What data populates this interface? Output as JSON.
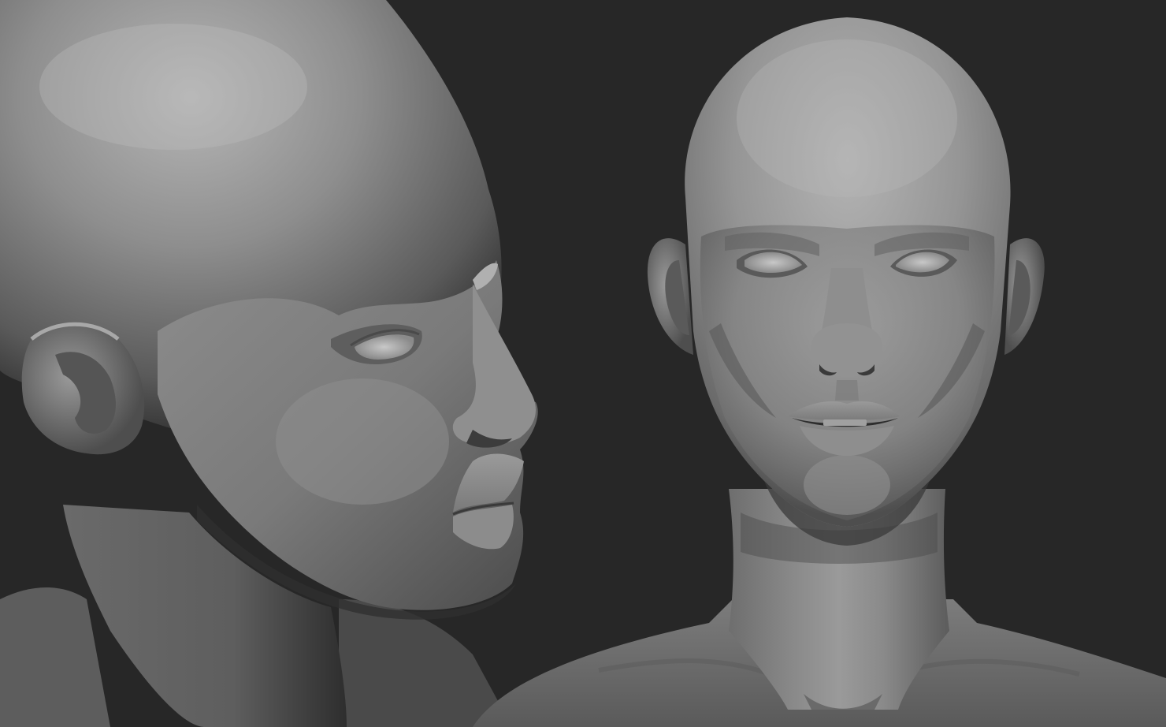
{
  "scene": {
    "subjects": [
      "side-view-head-sculpt",
      "front-view-head-sculpt"
    ],
    "background_color": "#272727",
    "material_base_color": "#8a8a8a",
    "material_highlight_color": "#bcbcbc",
    "material_shadow_color": "#3a3a3a"
  }
}
